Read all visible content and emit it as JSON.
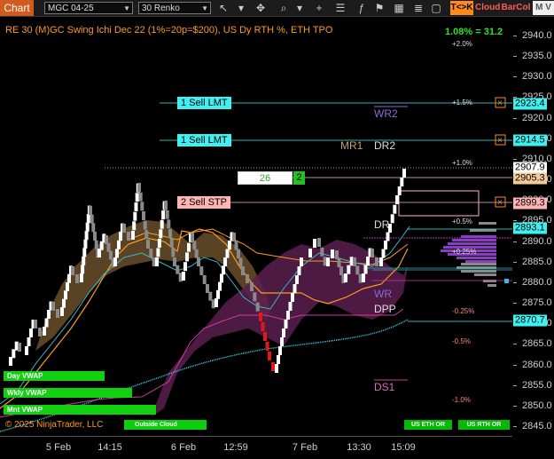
{
  "toolbar": {
    "title": "Chart",
    "instrument": "MGC 04-25",
    "period": "30 Renko",
    "btn_tk": "T<>K",
    "btn_cloud": "Cloud",
    "btn_barcol": "BarCol",
    "btn_m": "M V",
    "icons": [
      "cursor-icon",
      "magnify-icon",
      "pan-icon",
      "zoom-icon",
      "crosshair-icon",
      "draw-icon",
      "stats-icon",
      "strategy-icon",
      "table-icon",
      "properties-icon",
      "template-icon",
      "tile-icon",
      "back-icon"
    ]
  },
  "header": {
    "title": "RE 30 (M)GC Swing Ichi Dec 22 (1%=20p=$200), US Dy RTH %, ETH TPO",
    "stat": "1.08% = 31.2"
  },
  "axis": {
    "ticks": [
      "2940.0",
      "2935.0",
      "2930.0",
      "2925.0",
      "2920.0",
      "2915.0",
      "2910.0",
      "2905.0",
      "2900.0",
      "2895.0",
      "2890.0",
      "2885.0",
      "2880.0",
      "2875.0",
      "2870.0",
      "2865.0",
      "2860.0",
      "2855.0",
      "2850.0",
      "2845.0"
    ],
    "tick_values": [
      2940,
      2935,
      2930,
      2925,
      2920,
      2915,
      2910,
      2905,
      2900,
      2895,
      2890,
      2885,
      2880,
      2875,
      2870,
      2865,
      2860,
      2855,
      2850,
      2845
    ],
    "time_labels": [
      "5 Feb",
      "14:15",
      "6 Feb",
      "12:59",
      "7 Feb",
      "13:30",
      "15:09"
    ],
    "labels": [
      {
        "text": "2923.4",
        "value": 2923.4,
        "bg": "#3ff0f0"
      },
      {
        "text": "2914.5",
        "value": 2914.5,
        "bg": "#3ff0f0"
      },
      {
        "text": "2907.9",
        "value": 2907.9,
        "bg": "#ffffff"
      },
      {
        "text": "2905.3",
        "value": 2905.3,
        "bg": "#f5c89a"
      },
      {
        "text": "2899.3",
        "value": 2899.3,
        "bg": "#ffb4b4"
      },
      {
        "text": "2893.1",
        "value": 2893.1,
        "bg": "#3ff0f0"
      },
      {
        "text": "2870.7",
        "value": 2870.7,
        "bg": "#3ff0f0"
      }
    ]
  },
  "levels": [
    {
      "text": "+2.0%",
      "color": "#ddd"
    },
    {
      "text": "+1.5%",
      "color": "#ddd"
    },
    {
      "text": "+1.0%",
      "color": "#ddd"
    },
    {
      "text": "+0.5%",
      "color": "#ddd"
    },
    {
      "text": "+0.25%",
      "color": "#ddd"
    },
    {
      "text": "-0.25%",
      "color": "#ff8080"
    },
    {
      "text": "-0.5%",
      "color": "#ff8080"
    },
    {
      "text": "-1.0%",
      "color": "#ff8080"
    }
  ],
  "pivots": {
    "wr2": "WR2",
    "mr1": "MR1",
    "dr2": "DR2",
    "dr1": "DR",
    "wr1": "WR",
    "dpp": "DPP",
    "ds1": "DS1"
  },
  "orders": [
    {
      "label": "1 Sell LMT",
      "bg": "#3ff0f0"
    },
    {
      "label": "1 Sell LMT",
      "bg": "#3ff0f0"
    },
    {
      "label": "2 Sell STP",
      "bg": "#ffb4b4"
    }
  ],
  "position": {
    "qty": "26",
    "count": "2"
  },
  "vwap_labels": [
    "Day VWAP",
    "Wkly VWAP",
    "Mnt VWAP"
  ],
  "footer": {
    "copyright": "© 2025 NinjaTrader, LLC",
    "cloud_label": "Outside Cloud",
    "session_eth": "US ETH OR",
    "session_rth": "US RTH OR"
  }
}
